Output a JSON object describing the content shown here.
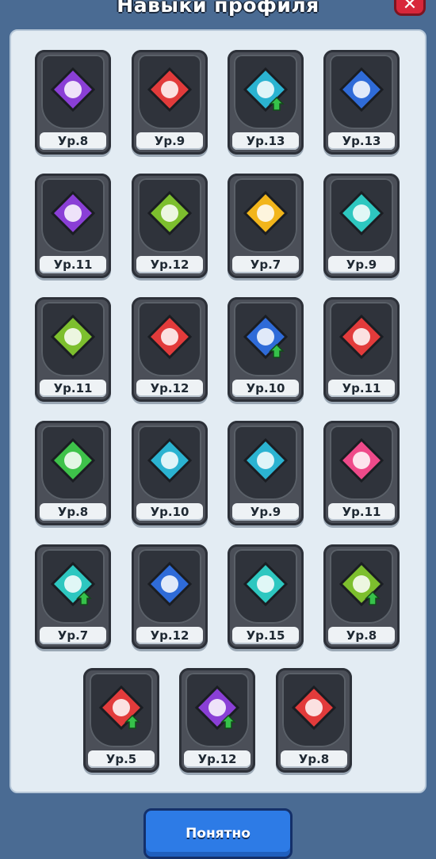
{
  "header": {
    "title": "Навыки профиля",
    "close_icon": "close-icon"
  },
  "skills": [
    {
      "level": "Ур.8",
      "icon": "map-bat",
      "color": "#8a3fd6"
    },
    {
      "level": "Ур.9",
      "icon": "sword-bulb",
      "color": "#e23b3b"
    },
    {
      "level": "Ур.13",
      "icon": "handshake-up",
      "color": "#2bb3d1"
    },
    {
      "level": "Ур.13",
      "icon": "sword-bomb",
      "color": "#2f6bd8"
    },
    {
      "level": "Ур.11",
      "icon": "sword-bat",
      "color": "#8a3fd6"
    },
    {
      "level": "Ур.12",
      "icon": "sword-hop",
      "color": "#7dbf2e"
    },
    {
      "level": "Ур.7",
      "icon": "max-arrow",
      "color": "#f2b51b"
    },
    {
      "level": "Ур.9",
      "icon": "map-wings",
      "color": "#2ec7c0"
    },
    {
      "level": "Ур.11",
      "icon": "map-hop",
      "color": "#7dbf2e"
    },
    {
      "level": "Ур.12",
      "icon": "map-wizard",
      "color": "#e23b3b"
    },
    {
      "level": "Ур.10",
      "icon": "bomb-up",
      "color": "#2f6bd8"
    },
    {
      "level": "Ур.11",
      "icon": "sword-wizard",
      "color": "#e23b3b"
    },
    {
      "level": "Ур.8",
      "icon": "map-mix",
      "color": "#3ec24a"
    },
    {
      "level": "Ур.10",
      "icon": "potion-wizard",
      "color": "#2bb3d1"
    },
    {
      "level": "Ур.9",
      "icon": "potion-plus",
      "color": "#2bb3d1"
    },
    {
      "level": "Ур.11",
      "icon": "monster-sword",
      "color": "#ef4a8a"
    },
    {
      "level": "Ур.7",
      "icon": "wings-up",
      "color": "#2ec7c0"
    },
    {
      "level": "Ур.12",
      "icon": "map-bomb",
      "color": "#2f6bd8"
    },
    {
      "level": "Ур.15",
      "icon": "sword-wings",
      "color": "#2ec7c0"
    },
    {
      "level": "Ур.8",
      "icon": "hop-up",
      "color": "#7dbf2e"
    },
    {
      "level": "Ур.5",
      "icon": "bulb-up",
      "color": "#e23b3b"
    },
    {
      "level": "Ур.12",
      "icon": "bat-up",
      "color": "#8a3fd6"
    },
    {
      "level": "Ур.8",
      "icon": "map-bulb",
      "color": "#e23b3b"
    }
  ],
  "footer": {
    "button_label": "Понятно"
  },
  "colors": {
    "background": "#4a6b93",
    "panel": "#e3ecf3",
    "button": "#2d7be6"
  }
}
